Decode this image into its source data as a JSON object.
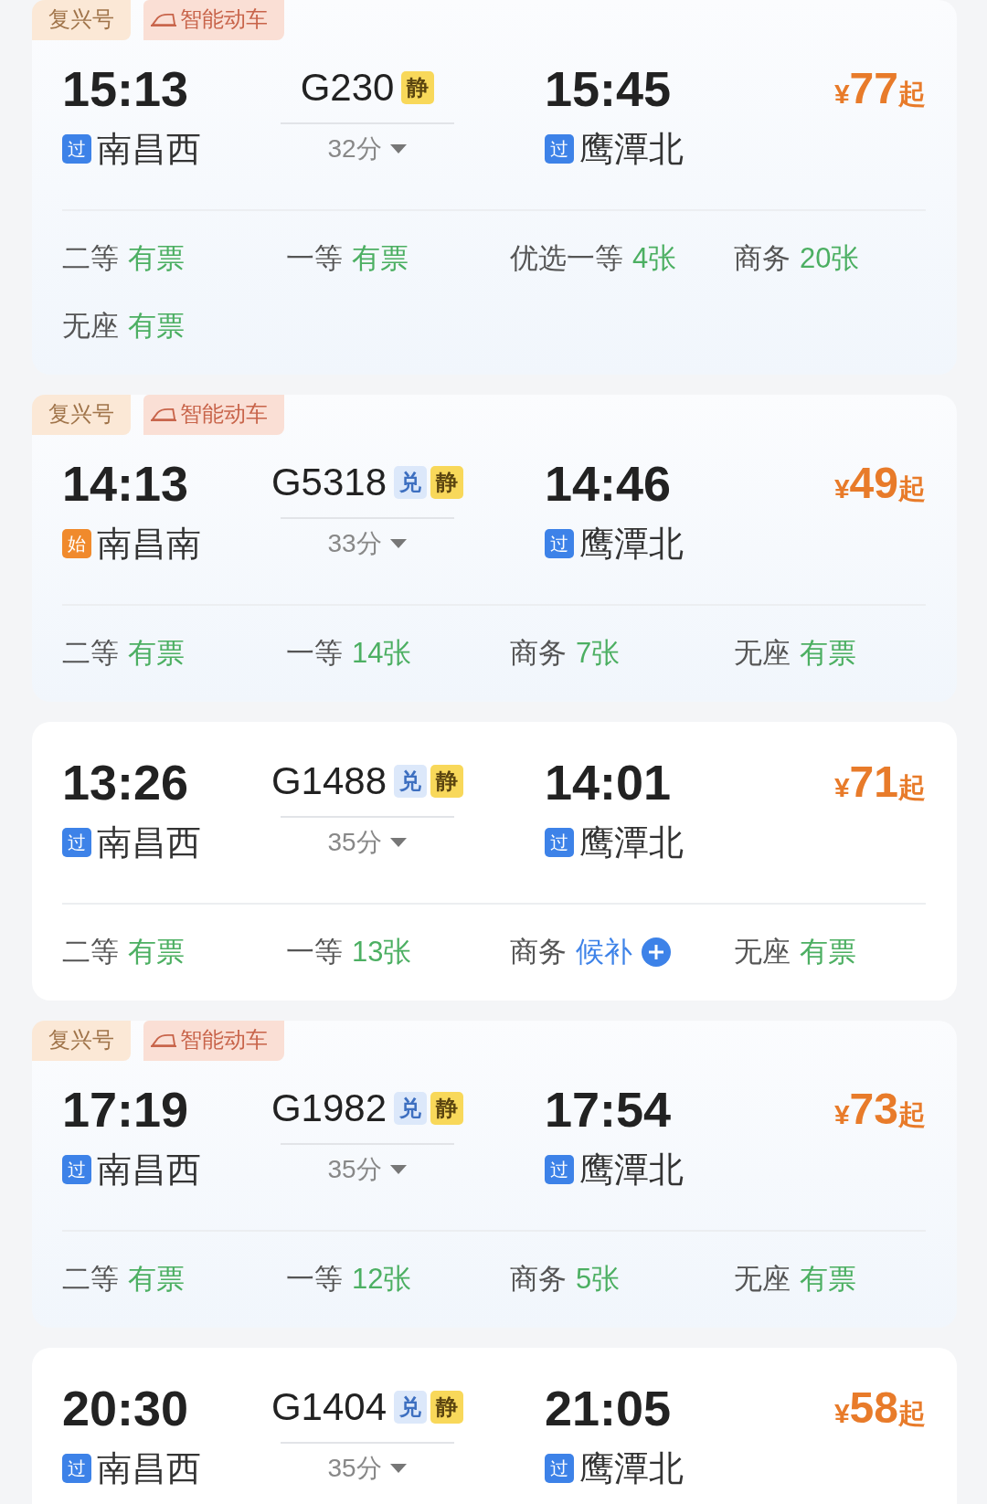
{
  "trains": [
    {
      "tags": [
        {
          "text": "复兴号",
          "kind": "brand"
        },
        {
          "text": "智能动车",
          "kind": "smart"
        }
      ],
      "depart": "15:13",
      "from_badge": {
        "text": "过",
        "kind": "pass"
      },
      "from": "南昌西",
      "number": "G230",
      "badges": [
        {
          "text": "静",
          "kind": "quiet"
        }
      ],
      "duration": "32分",
      "arrive": "15:45",
      "to_badge": {
        "text": "过",
        "kind": "pass"
      },
      "to": "鹰潭北",
      "price": {
        "currency": "¥",
        "amount": "77",
        "suffix": "起"
      },
      "seats": [
        {
          "class": "二等",
          "status": "有票",
          "kind": "available"
        },
        {
          "class": "一等",
          "status": "有票",
          "kind": "available"
        },
        {
          "class": "优选一等",
          "status": "4张",
          "kind": "available"
        },
        {
          "class": "商务",
          "status": "20张",
          "kind": "available"
        },
        {
          "class": "无座",
          "status": "有票",
          "kind": "available"
        }
      ]
    },
    {
      "tags": [
        {
          "text": "复兴号",
          "kind": "brand"
        },
        {
          "text": "智能动车",
          "kind": "smart"
        }
      ],
      "depart": "14:13",
      "from_badge": {
        "text": "始",
        "kind": "start"
      },
      "from": "南昌南",
      "number": "G5318",
      "badges": [
        {
          "text": "兑",
          "kind": "exchange"
        },
        {
          "text": "静",
          "kind": "quiet"
        }
      ],
      "duration": "33分",
      "arrive": "14:46",
      "to_badge": {
        "text": "过",
        "kind": "pass"
      },
      "to": "鹰潭北",
      "price": {
        "currency": "¥",
        "amount": "49",
        "suffix": "起"
      },
      "seats": [
        {
          "class": "二等",
          "status": "有票",
          "kind": "available"
        },
        {
          "class": "一等",
          "status": "14张",
          "kind": "available"
        },
        {
          "class": "商务",
          "status": "7张",
          "kind": "available"
        },
        {
          "class": "无座",
          "status": "有票",
          "kind": "available"
        }
      ]
    },
    {
      "depart": "13:26",
      "from_badge": {
        "text": "过",
        "kind": "pass"
      },
      "from": "南昌西",
      "number": "G1488",
      "badges": [
        {
          "text": "兑",
          "kind": "exchange"
        },
        {
          "text": "静",
          "kind": "quiet"
        }
      ],
      "duration": "35分",
      "arrive": "14:01",
      "to_badge": {
        "text": "过",
        "kind": "pass"
      },
      "to": "鹰潭北",
      "price": {
        "currency": "¥",
        "amount": "71",
        "suffix": "起"
      },
      "seats": [
        {
          "class": "二等",
          "status": "有票",
          "kind": "available"
        },
        {
          "class": "一等",
          "status": "13张",
          "kind": "available"
        },
        {
          "class": "商务",
          "status": "候补",
          "kind": "waitlist"
        },
        {
          "class": "无座",
          "status": "有票",
          "kind": "available"
        }
      ]
    },
    {
      "tags": [
        {
          "text": "复兴号",
          "kind": "brand"
        },
        {
          "text": "智能动车",
          "kind": "smart"
        }
      ],
      "depart": "17:19",
      "from_badge": {
        "text": "过",
        "kind": "pass"
      },
      "from": "南昌西",
      "number": "G1982",
      "badges": [
        {
          "text": "兑",
          "kind": "exchange"
        },
        {
          "text": "静",
          "kind": "quiet"
        }
      ],
      "duration": "35分",
      "arrive": "17:54",
      "to_badge": {
        "text": "过",
        "kind": "pass"
      },
      "to": "鹰潭北",
      "price": {
        "currency": "¥",
        "amount": "73",
        "suffix": "起"
      },
      "seats": [
        {
          "class": "二等",
          "status": "有票",
          "kind": "available"
        },
        {
          "class": "一等",
          "status": "12张",
          "kind": "available"
        },
        {
          "class": "商务",
          "status": "5张",
          "kind": "available"
        },
        {
          "class": "无座",
          "status": "有票",
          "kind": "available"
        }
      ]
    },
    {
      "depart": "20:30",
      "from_badge": {
        "text": "过",
        "kind": "pass"
      },
      "from": "南昌西",
      "number": "G1404",
      "badges": [
        {
          "text": "兑",
          "kind": "exchange"
        },
        {
          "text": "静",
          "kind": "quiet"
        }
      ],
      "duration": "35分",
      "arrive": "21:05",
      "to_badge": {
        "text": "过",
        "kind": "pass"
      },
      "to": "鹰潭北",
      "price": {
        "currency": "¥",
        "amount": "58",
        "suffix": "起"
      }
    }
  ]
}
